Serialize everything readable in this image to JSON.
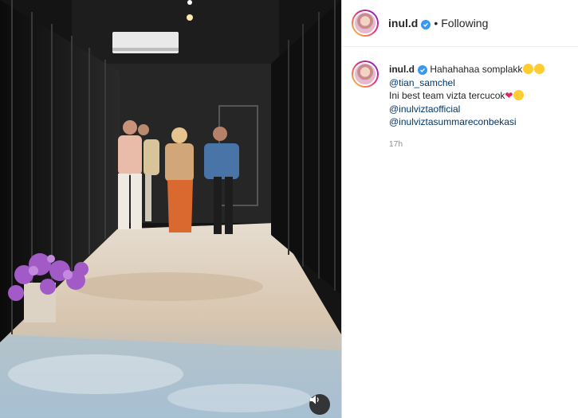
{
  "post": {
    "media": {
      "description_icon": "video-post",
      "mute_icon": "speaker-icon"
    },
    "header": {
      "username": "inul.d",
      "separator": "•",
      "follow_state": "Following"
    },
    "caption": {
      "username": "inul.d",
      "line1": "Hahahahaa somplakk",
      "mention1": "@tian_samchel",
      "line2": "Ini best team vizta tercucok",
      "mention2": "@inulviztaofficial",
      "mention3": "@inulviztasummareconbekasi",
      "time": "17h"
    }
  },
  "colors": {
    "verified": "#3897f0",
    "mention": "#00376b",
    "muted": "#8e8e8e"
  }
}
